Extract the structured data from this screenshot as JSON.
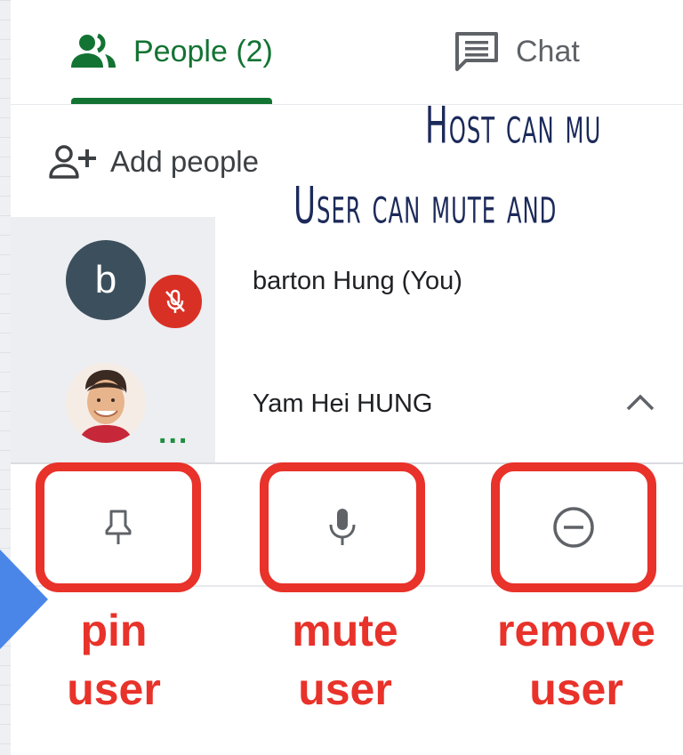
{
  "tabs": {
    "people_label": "People (2)",
    "chat_label": "Chat"
  },
  "add_people_label": "Add people",
  "annotation": {
    "line1": "Host can mu",
    "line2": "User can mute and"
  },
  "participants": [
    {
      "initial": "b",
      "name": "barton Hung (You)",
      "muted": true
    },
    {
      "name": "Yam Hei HUNG",
      "more": "..."
    }
  ],
  "actions": {
    "pin_label_1": "pin",
    "pin_label_2": "user",
    "mute_label_1": "mute",
    "mute_label_2": "user",
    "remove_label_1": "remove",
    "remove_label_2": "user"
  },
  "colors": {
    "accent_green": "#137333",
    "highlight_red": "#e8322a",
    "mute_red": "#d93025",
    "annotation_navy": "#1c2a5a",
    "slide_blue": "#4a86e8"
  },
  "icons": [
    "people-icon",
    "chat-icon",
    "add-person-icon",
    "mic-off-icon",
    "chevron-up-icon",
    "pin-icon",
    "mic-icon",
    "remove-icon"
  ]
}
